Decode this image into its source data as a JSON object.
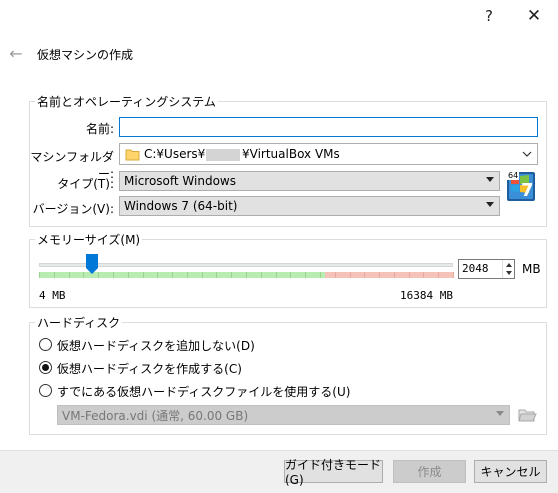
{
  "window": {
    "help_glyph": "?",
    "close_glyph": "✕",
    "back_glyph": "←",
    "title": "仮想マシンの作成"
  },
  "name_os": {
    "group_title": "名前とオペレーティングシステム",
    "name_label": "名前:",
    "name_value": "",
    "folder_label": "マシンフォルダー:",
    "folder_value": "C:¥Users¥",
    "folder_value_suffix": "¥VirtualBox VMs",
    "type_label": "タイプ(T):",
    "type_value": "Microsoft Windows",
    "version_label": "バージョン(V):",
    "version_value": "Windows 7 (64-bit)",
    "os_icon_badge": "64",
    "os_icon_number": "7"
  },
  "memory": {
    "group_title": "メモリーサイズ(M)",
    "value": "2048",
    "unit": "MB",
    "min_label": "4 MB",
    "max_label": "16384 MB",
    "min_mb": 4,
    "max_mb": 16384,
    "current_mb": 2048
  },
  "disk": {
    "group_title": "ハードディスク",
    "options": [
      {
        "label": "仮想ハードディスクを追加しない(D)",
        "checked": false
      },
      {
        "label": "仮想ハードディスクを作成する(C)",
        "checked": true
      },
      {
        "label": "すでにある仮想ハードディスクファイルを使用する(U)",
        "checked": false
      }
    ],
    "existing_file": "VM-Fedora.vdi (通常, 60.00 GB)"
  },
  "buttons": {
    "guided": "ガイド付きモード(G)",
    "create": "作成",
    "cancel": "キャンセル"
  },
  "colors": {
    "accent": "#0078d7",
    "slider_safe": "#b8ecb0",
    "slider_danger": "#f4c2b8"
  }
}
